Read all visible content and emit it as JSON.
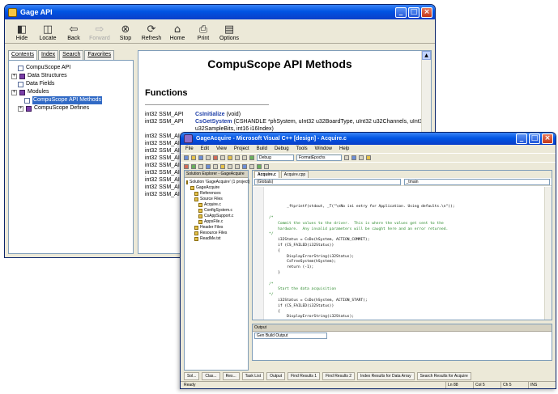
{
  "help_window": {
    "title": "Gage API",
    "toolbar": [
      {
        "label": "Hide",
        "icon": "hide-icon",
        "glyph": "◧",
        "enabled": true
      },
      {
        "label": "Locate",
        "icon": "locate-icon",
        "glyph": "◫",
        "enabled": true
      },
      {
        "label": "Back",
        "icon": "back-arrow-icon",
        "glyph": "⇦",
        "enabled": true
      },
      {
        "label": "Forward",
        "icon": "forward-arrow-icon",
        "glyph": "⇨",
        "enabled": false
      },
      {
        "label": "Stop",
        "icon": "stop-icon",
        "glyph": "⊗",
        "enabled": true
      },
      {
        "label": "Refresh",
        "icon": "refresh-icon",
        "glyph": "⟳",
        "enabled": true
      },
      {
        "label": "Home",
        "icon": "home-icon",
        "glyph": "⌂",
        "enabled": true
      },
      {
        "label": "Print",
        "icon": "print-icon",
        "glyph": "⎙",
        "enabled": true
      },
      {
        "label": "Options",
        "icon": "options-icon",
        "glyph": "▤",
        "enabled": true
      }
    ],
    "tabs": [
      "Contents",
      "Index",
      "Search",
      "Favorites"
    ],
    "tree": [
      {
        "label": "CompuScope API",
        "indent": 1,
        "icon": "page",
        "selected": false
      },
      {
        "label": "Data Structures",
        "indent": 0,
        "icon": "book",
        "selected": false
      },
      {
        "label": "Data Fields",
        "indent": 1,
        "icon": "page",
        "selected": false
      },
      {
        "label": "Modules",
        "indent": 0,
        "icon": "book",
        "selected": false
      },
      {
        "label": "CompuScope API Methods",
        "indent": 2,
        "icon": "page",
        "selected": true
      },
      {
        "label": "CompuScope Defines",
        "indent": 1,
        "icon": "book",
        "selected": false
      }
    ],
    "content": {
      "page_title": "CompuScope API Methods",
      "functions_heading": "Functions",
      "rows": [
        {
          "ret": "int32 SSM_API",
          "name": "CsInitialize",
          "args": "(void)"
        },
        {
          "ret": "int32 SSM_API",
          "name": "CsGetSystem",
          "args": "(CSHANDLE *phSystem, uInt32 u32BoardType, uInt32 u32Channels, uInt32 u32SampleBits, int16 i16Index)"
        },
        {
          "ret": "",
          "name": "",
          "args": ""
        },
        {
          "ret": "int32 SSM_AI",
          "name": "",
          "args": ""
        },
        {
          "ret": "int32 SSM_AI",
          "name": "",
          "args": ""
        },
        {
          "ret": "",
          "name": "",
          "args": ""
        },
        {
          "ret": "int32 SSM_AI",
          "name": "",
          "args": ""
        },
        {
          "ret": "int32 SSM_AI",
          "name": "",
          "args": ""
        },
        {
          "ret": "int32 SSM_AI",
          "name": "",
          "args": ""
        },
        {
          "ret": "int32 SSM_AI",
          "name": "",
          "args": ""
        },
        {
          "ret": "int32 SSM_AI",
          "name": "",
          "args": ""
        },
        {
          "ret": "",
          "name": "",
          "args": ""
        },
        {
          "ret": "int32 SSM_AI",
          "name": "",
          "args": ""
        },
        {
          "ret": "int32 SSM_AI",
          "name": "",
          "args": ""
        }
      ]
    }
  },
  "vs_window": {
    "title": "GageAcquire - Microsoft Visual C++ [design] - Acquire.c",
    "menu": [
      "File",
      "Edit",
      "View",
      "Project",
      "Build",
      "Debug",
      "Tools",
      "Window",
      "Help"
    ],
    "config_combo": "Debug",
    "platform_combo": "FormatEpochs",
    "solution_pane_title": "Solution Explorer - GageAcquire",
    "solution_tree": [
      {
        "label": "Solution 'GageAcquire' (1 project)",
        "indent": 0
      },
      {
        "label": "GageAcquire",
        "indent": 1
      },
      {
        "label": "References",
        "indent": 2
      },
      {
        "label": "Source Files",
        "indent": 2
      },
      {
        "label": "Acquire.c",
        "indent": 3
      },
      {
        "label": "ConfigSystem.c",
        "indent": 3
      },
      {
        "label": "CsAppSupport.c",
        "indent": 3
      },
      {
        "label": "AppsFile.c",
        "indent": 3
      },
      {
        "label": "Header Files",
        "indent": 2
      },
      {
        "label": "Resource Files",
        "indent": 2
      },
      {
        "label": "ReadMe.txt",
        "indent": 2
      }
    ],
    "doc_tabs": [
      "Acquire.c",
      "Acquire.cpp"
    ],
    "nav_left": "(Globals)",
    "nav_right": "_tmain",
    "code_lines": [
      {
        "text": "        _ftprintf(stdout, _T(\"\\nNo ini entry for Application. Using defaults.\\n\"));",
        "type": "kw"
      },
      {
        "text": "",
        "type": "kw"
      },
      {
        "text": "/*",
        "type": "cmt"
      },
      {
        "text": "    Commit the values to the driver.  This is where the values get sent to the",
        "type": "cmt"
      },
      {
        "text": "    hardware.  Any invalid parameters will be caught here and an error returned.",
        "type": "cmt"
      },
      {
        "text": "*/",
        "type": "cmt"
      },
      {
        "text": "    i32Status = CsDo(hSystem, ACTION_COMMIT);",
        "type": "kw"
      },
      {
        "text": "    if (CS_FAILED(i32Status))",
        "type": "kw"
      },
      {
        "text": "    {",
        "type": "kw"
      },
      {
        "text": "        DisplayErrorString(i32Status);",
        "type": "kw"
      },
      {
        "text": "        CsFreeSystem(hSystem);",
        "type": "kw"
      },
      {
        "text": "        return (-1);",
        "type": "kw"
      },
      {
        "text": "    }",
        "type": "kw"
      },
      {
        "text": "",
        "type": "kw"
      },
      {
        "text": "/*",
        "type": "cmt"
      },
      {
        "text": "    Start the data acquisition",
        "type": "cmt"
      },
      {
        "text": "*/",
        "type": "cmt"
      },
      {
        "text": "    i32Status = CsDo(hSystem, ACTION_START);",
        "type": "kw"
      },
      {
        "text": "    if (CS_FAILED(i32Status))",
        "type": "kw"
      },
      {
        "text": "    {",
        "type": "kw"
      },
      {
        "text": "        DisplayErrorString(i32Status);",
        "type": "kw"
      }
    ],
    "output_title": "Output",
    "output_combo": "Gen Build Output",
    "bottom_tabs": [
      "Sol...",
      "Clas...",
      "Res...",
      "Task List",
      "Output",
      "Find Results 1",
      "Find Results 2",
      "Index Results for Data Array",
      "Search Results for Acquire"
    ],
    "status": {
      "ready": "Ready",
      "ln": "Ln 88",
      "col": "Col 5",
      "ch": "Ch 5",
      "mode": "INS"
    }
  }
}
